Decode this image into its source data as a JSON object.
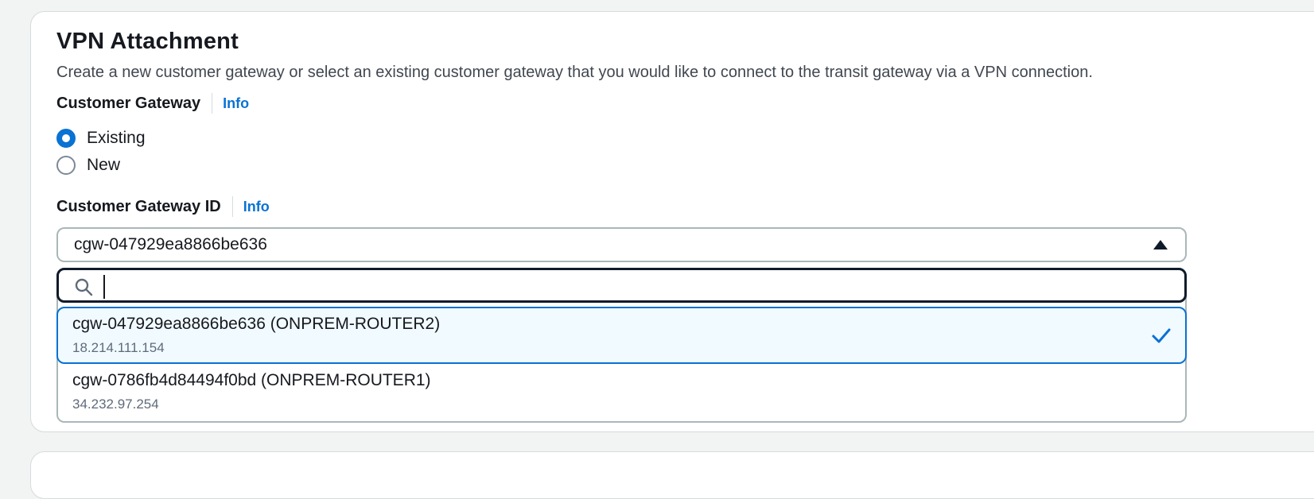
{
  "section": {
    "title": "VPN Attachment",
    "description": "Create a new customer gateway or select an existing customer gateway that you would like to connect to the transit gateway via a VPN connection."
  },
  "customer_gateway": {
    "label": "Customer Gateway",
    "info_label": "Info",
    "options": [
      {
        "label": "Existing",
        "checked": true
      },
      {
        "label": "New",
        "checked": false
      }
    ]
  },
  "customer_gateway_id": {
    "label": "Customer Gateway ID",
    "info_label": "Info",
    "selected_value": "cgw-047929ea8866be636",
    "search_value": "",
    "options": [
      {
        "title": "cgw-047929ea8866be636 (ONPREM-ROUTER2)",
        "ip": "18.214.111.154",
        "selected": true
      },
      {
        "title": "cgw-0786fb4d84494f0bd (ONPREM-ROUTER1)",
        "ip": "34.232.97.254",
        "selected": false
      }
    ]
  },
  "colors": {
    "accent": "#0972d3",
    "selected_bg": "#f1faff",
    "text": "#16191f",
    "muted": "#5f6b7a"
  }
}
